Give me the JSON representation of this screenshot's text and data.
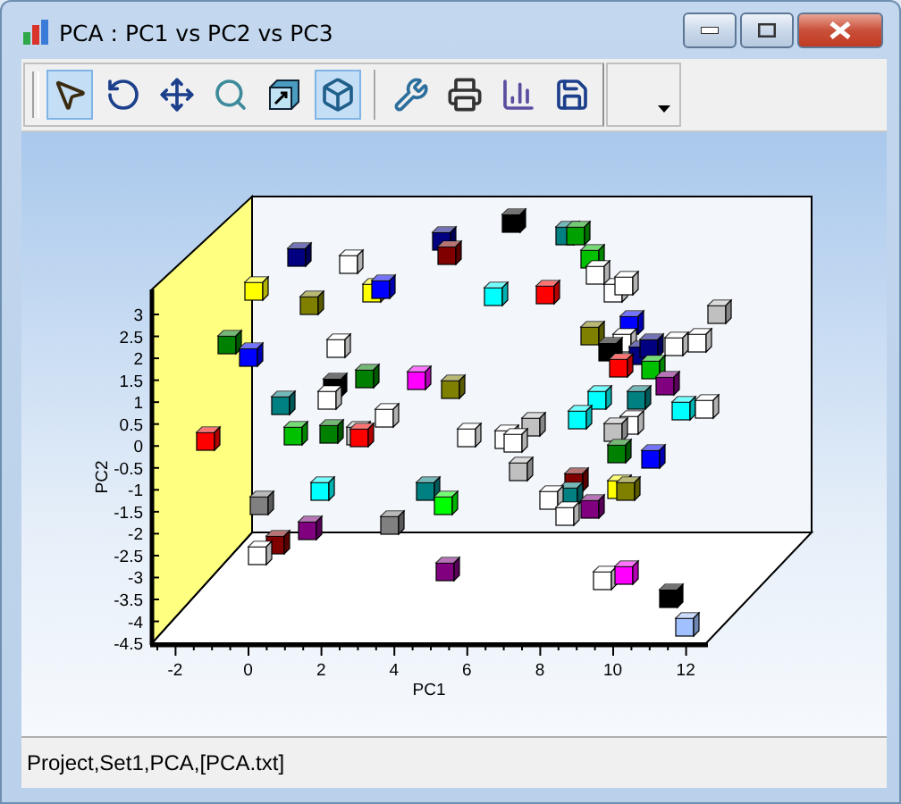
{
  "window": {
    "title": "PCA : PC1 vs PC2 vs PC3"
  },
  "toolbar": [
    {
      "kind": "pointer",
      "selected": true
    },
    {
      "kind": "rotate",
      "selected": false
    },
    {
      "kind": "move",
      "selected": false
    },
    {
      "kind": "zoom",
      "selected": false
    },
    {
      "kind": "scale",
      "selected": false
    },
    {
      "kind": "view3d",
      "selected": true
    },
    {
      "kind": "separator"
    },
    {
      "kind": "tools",
      "selected": false
    },
    {
      "kind": "print",
      "selected": false
    },
    {
      "kind": "copy",
      "selected": false
    },
    {
      "kind": "save",
      "selected": false
    }
  ],
  "plot": {
    "xlabel": "PC1",
    "ylabel": "PC2",
    "xticks": [
      "-2",
      "0",
      "2",
      "4",
      "6",
      "8",
      "10",
      "12"
    ],
    "yticks": [
      "3",
      "2.5",
      "2",
      "1.5",
      "1",
      "0.5",
      "0",
      "-0.5",
      "-1",
      "-1.5",
      "-2",
      "-2.5",
      "-3",
      "-3.5",
      "-4",
      "-4.5"
    ]
  },
  "status_bar": {
    "text": "Project,Set1,PCA,[PCA.txt]"
  }
}
